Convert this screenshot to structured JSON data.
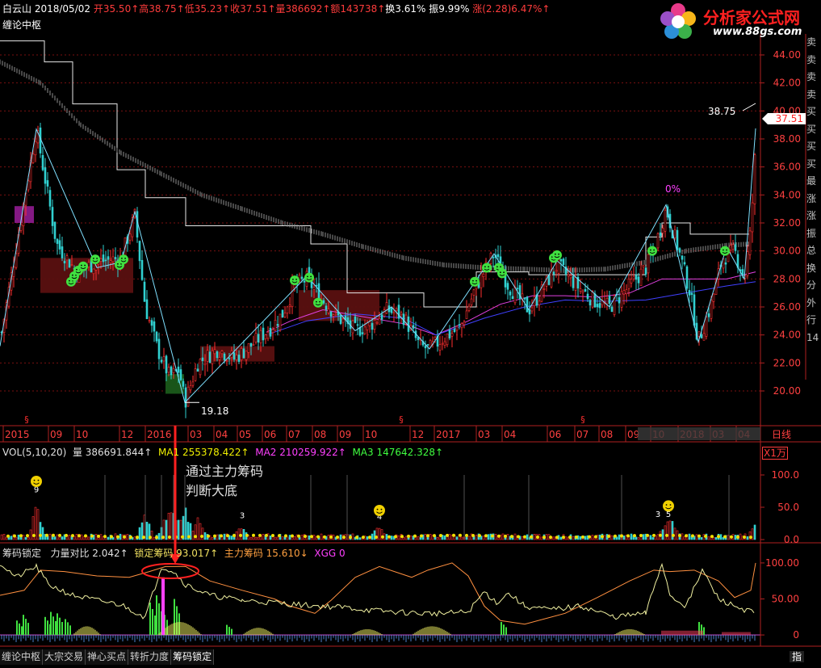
{
  "header": {
    "name": "白云山",
    "date": "2018/05/02",
    "open": "开35.50↑",
    "high": "高38.75↑",
    "low": "低35.23↑",
    "close": "收37.51↑",
    "volume": "量386692↑",
    "amount": "额143738↑",
    "turnover": "换3.61%",
    "amplitude": "振9.99%",
    "change": "涨(2.28)6.47%↑",
    "indicator_name": "缠论中枢"
  },
  "logo": {
    "title": "分析家公式网",
    "url_text": "www.88gs.com"
  },
  "right_panel": [
    "卖",
    "卖",
    "卖",
    "卖",
    "买",
    "买",
    "买",
    "买",
    "最",
    "涨",
    "涨",
    "振",
    "总",
    "换",
    "分",
    "外",
    "行",
    "14"
  ],
  "volume_header": {
    "label": "VOL(5,10,20)",
    "volume": "量 386691.844↑",
    "ma1": "MA1 255378.422↑",
    "ma2": "MA2 210259.922↑",
    "ma3": "MA3 147642.328↑",
    "unit": "X1万"
  },
  "chip_header": {
    "label": "筹码锁定",
    "ratio": "力量对比 2.042↑",
    "lock": "锁定筹码 93.017↑",
    "main": "主力筹码 15.610↓",
    "xgg": "XGG 0"
  },
  "annotation": {
    "line1": "通过主力筹码",
    "line2": "判断大底"
  },
  "price_labels": {
    "low_label": "19.18",
    "high_label": "38.75",
    "last_price": "37.51",
    "pct_label": "0%"
  },
  "tabs": [
    "缠论中枢",
    "大宗交易",
    "禅心买点",
    "转折力度",
    "筹码锁定"
  ],
  "corner_tab": "指",
  "chart_data": [
    {
      "type": "candlestick",
      "title": "缠论中枢",
      "ylim": [
        18.5,
        45.5
      ],
      "yticks": [
        "20.00",
        "22.00",
        "24.00",
        "26.00",
        "28.00",
        "30.00",
        "32.00",
        "34.00",
        "36.00",
        "38.00",
        "40.00",
        "42.00",
        "44.00"
      ],
      "x_ticks": [
        "2015",
        "09",
        "10",
        "12",
        "2016",
        "03",
        "04",
        "05",
        "06",
        "07",
        "08",
        "09",
        "10",
        "12",
        "2017",
        "03",
        "04",
        "06",
        "07",
        "08",
        "09",
        "10",
        "2018",
        "03",
        "04"
      ],
      "period_label": "日线",
      "close_path": [
        [
          0,
          23.5
        ],
        [
          45,
          38.7
        ],
        [
          70,
          30.5
        ],
        [
          95,
          28.5
        ],
        [
          120,
          29.2
        ],
        [
          150,
          29.5
        ],
        [
          167,
          32.5
        ],
        [
          180,
          26.0
        ],
        [
          195,
          23.0
        ],
        [
          210,
          21.0
        ],
        [
          222,
          21.5
        ],
        [
          229,
          19.2
        ],
        [
          245,
          22.0
        ],
        [
          270,
          23.0
        ],
        [
          290,
          22.3
        ],
        [
          310,
          23.2
        ],
        [
          335,
          24.5
        ],
        [
          350,
          25.5
        ],
        [
          365,
          27.5
        ],
        [
          380,
          28.0
        ],
        [
          400,
          26.5
        ],
        [
          420,
          25.2
        ],
        [
          440,
          24.3
        ],
        [
          460,
          24.8
        ],
        [
          480,
          25.8
        ],
        [
          500,
          25.3
        ],
        [
          520,
          23.2
        ],
        [
          532,
          23.0
        ],
        [
          550,
          23.8
        ],
        [
          570,
          24.5
        ],
        [
          590,
          27.5
        ],
        [
          612,
          29.8
        ],
        [
          630,
          27.5
        ],
        [
          655,
          25.8
        ],
        [
          670,
          27.0
        ],
        [
          690,
          29.0
        ],
        [
          715,
          27.5
        ],
        [
          735,
          26.5
        ],
        [
          755,
          26.0
        ],
        [
          780,
          27.5
        ],
        [
          800,
          28.8
        ],
        [
          810,
          30.0
        ],
        [
          825,
          33.0
        ],
        [
          840,
          30.2
        ],
        [
          855,
          27.0
        ],
        [
          865,
          23.5
        ],
        [
          880,
          26.0
        ],
        [
          895,
          29.5
        ],
        [
          910,
          30.0
        ],
        [
          922,
          28.0
        ],
        [
          930,
          31.5
        ],
        [
          936,
          37.5
        ]
      ],
      "zigzag": [
        [
          0,
          23.2
        ],
        [
          45,
          38.7
        ],
        [
          120,
          28.8
        ],
        [
          150,
          29.2
        ],
        [
          167,
          32.8
        ],
        [
          229,
          19.18
        ],
        [
          380,
          28.2
        ],
        [
          440,
          24.3
        ],
        [
          485,
          26.0
        ],
        [
          532,
          23.0
        ],
        [
          612,
          29.8
        ],
        [
          655,
          25.8
        ],
        [
          690,
          29.3
        ],
        [
          755,
          26.0
        ],
        [
          825,
          33.3
        ],
        [
          865,
          23.5
        ],
        [
          900,
          30.3
        ],
        [
          922,
          28.0
        ],
        [
          936,
          38.75
        ]
      ],
      "zhongshu": [
        {
          "x0": 50,
          "x1": 165,
          "low": 27.0,
          "high": 29.5,
          "color": "#5a1010"
        },
        {
          "x0": 248,
          "x1": 340,
          "low": 22.1,
          "high": 23.2,
          "color": "#5a1010"
        },
        {
          "x0": 370,
          "x1": 470,
          "low": 25.0,
          "high": 27.2,
          "color": "#5a1010"
        },
        {
          "x0": 205,
          "x1": 228,
          "low": 19.8,
          "high": 21.2,
          "color": "#1a5a1a"
        },
        {
          "x0": 18,
          "x1": 42,
          "low": 32.0,
          "high": 33.2,
          "color": "#8a1a8a"
        }
      ],
      "envelope_upper": [
        [
          0,
          45.0
        ],
        [
          55,
          45.0
        ],
        [
          55,
          43.5
        ],
        [
          90,
          43.5
        ],
        [
          90,
          40.5
        ],
        [
          145,
          40.5
        ],
        [
          145,
          35.8
        ],
        [
          180,
          35.8
        ],
        [
          180,
          33.8
        ],
        [
          230,
          33.8
        ],
        [
          230,
          31.8
        ],
        [
          385,
          31.8
        ],
        [
          385,
          30.5
        ],
        [
          430,
          30.5
        ],
        [
          430,
          27.0
        ],
        [
          525,
          27.0
        ],
        [
          525,
          26.0
        ],
        [
          590,
          26.0
        ],
        [
          590,
          28.5
        ],
        [
          655,
          28.5
        ],
        [
          655,
          28.3
        ],
        [
          800,
          28.3
        ],
        [
          800,
          31.0
        ],
        [
          820,
          31.0
        ],
        [
          820,
          32.0
        ],
        [
          855,
          32.0
        ],
        [
          855,
          31.2
        ],
        [
          930,
          31.2
        ]
      ],
      "long_ma": [
        [
          0,
          43.5
        ],
        [
          50,
          42.0
        ],
        [
          100,
          39.0
        ],
        [
          150,
          37.0
        ],
        [
          200,
          35.5
        ],
        [
          250,
          34.0
        ],
        [
          300,
          33.0
        ],
        [
          350,
          32.0
        ],
        [
          400,
          31.2
        ],
        [
          450,
          30.3
        ],
        [
          500,
          29.5
        ],
        [
          550,
          29.0
        ],
        [
          600,
          28.8
        ],
        [
          650,
          28.7
        ],
        [
          700,
          28.6
        ],
        [
          750,
          28.7
        ],
        [
          800,
          29.2
        ],
        [
          850,
          30.0
        ],
        [
          900,
          30.4
        ],
        [
          930,
          30.5
        ]
      ],
      "ma_pink": [
        [
          330,
          24.2
        ],
        [
          360,
          25.0
        ],
        [
          400,
          25.8
        ],
        [
          450,
          25.3
        ],
        [
          500,
          24.8
        ],
        [
          540,
          24.0
        ],
        [
          580,
          25.0
        ],
        [
          620,
          26.2
        ],
        [
          660,
          26.8
        ],
        [
          700,
          26.8
        ],
        [
          740,
          26.7
        ],
        [
          780,
          27.0
        ],
        [
          820,
          28.0
        ],
        [
          860,
          28.0
        ],
        [
          900,
          28.0
        ],
        [
          936,
          28.5
        ]
      ],
      "ma_blue": [
        [
          330,
          24.0
        ],
        [
          380,
          25.0
        ],
        [
          440,
          25.5
        ],
        [
          500,
          25.2
        ],
        [
          540,
          24.0
        ],
        [
          600,
          25.2
        ],
        [
          650,
          26.0
        ],
        [
          700,
          26.5
        ],
        [
          750,
          26.4
        ],
        [
          800,
          26.5
        ],
        [
          850,
          27.0
        ],
        [
          900,
          27.5
        ],
        [
          936,
          27.8
        ]
      ],
      "smileys": [
        [
          88,
          27.8
        ],
        [
          92,
          28.2
        ],
        [
          97,
          28.6
        ],
        [
          103,
          28.9
        ],
        [
          118,
          29.4
        ],
        [
          148,
          29.0
        ],
        [
          153,
          29.4
        ],
        [
          365,
          27.9
        ],
        [
          383,
          28.1
        ],
        [
          394,
          26.3
        ],
        [
          588,
          27.8
        ],
        [
          603,
          28.8
        ],
        [
          618,
          28.8
        ],
        [
          622,
          28.4
        ],
        [
          686,
          29.5
        ],
        [
          690,
          29.7
        ],
        [
          808,
          30.0
        ],
        [
          898,
          30.0
        ]
      ],
      "signals_x": [
        33,
        497,
        722
      ]
    },
    {
      "type": "bar",
      "title": "VOL(5,10,20)",
      "ylim": [
        0,
        120
      ],
      "yticks": [
        "0.0",
        "50.0",
        "100.0"
      ],
      "unit": "X1万",
      "spikes": [
        [
          45,
          60
        ],
        [
          180,
          45
        ],
        [
          205,
          40
        ],
        [
          215,
          42
        ],
        [
          229,
          50
        ],
        [
          245,
          35
        ],
        [
          300,
          20
        ],
        [
          470,
          18
        ],
        [
          825,
          22
        ],
        [
          832,
          25
        ],
        [
          936,
          28
        ]
      ],
      "spike_labels": [
        {
          "x": 45,
          "text": "9"
        },
        {
          "x": 300,
          "text": "3"
        },
        {
          "x": 470,
          "text": "4"
        },
        {
          "x": 815,
          "text": "3"
        },
        {
          "x": 828,
          "text": "5"
        }
      ],
      "smileys": [
        [
          45,
          90
        ],
        [
          470,
          45
        ],
        [
          828,
          52
        ]
      ]
    },
    {
      "type": "line",
      "title": "筹码锁定",
      "ylim": [
        -10,
        110
      ],
      "yticks": [
        "0",
        "50.00",
        "100.00"
      ],
      "lock_line": [
        [
          0,
          55
        ],
        [
          30,
          62
        ],
        [
          50,
          90
        ],
        [
          80,
          88
        ],
        [
          120,
          82
        ],
        [
          160,
          80
        ],
        [
          185,
          88
        ],
        [
          205,
          95
        ],
        [
          230,
          95
        ],
        [
          260,
          75
        ],
        [
          300,
          62
        ],
        [
          340,
          50
        ],
        [
          360,
          40
        ],
        [
          390,
          30
        ],
        [
          410,
          48
        ],
        [
          440,
          80
        ],
        [
          470,
          95
        ],
        [
          510,
          80
        ],
        [
          530,
          90
        ],
        [
          560,
          100
        ],
        [
          580,
          82
        ],
        [
          600,
          40
        ],
        [
          620,
          20
        ],
        [
          650,
          15
        ],
        [
          700,
          30
        ],
        [
          740,
          52
        ],
        [
          780,
          75
        ],
        [
          810,
          90
        ],
        [
          830,
          88
        ],
        [
          860,
          90
        ],
        [
          890,
          75
        ],
        [
          910,
          52
        ],
        [
          930,
          62
        ],
        [
          936,
          100
        ]
      ],
      "main_line": [
        [
          0,
          100
        ],
        [
          20,
          80
        ],
        [
          45,
          95
        ],
        [
          60,
          70
        ],
        [
          90,
          55
        ],
        [
          120,
          48
        ],
        [
          150,
          42
        ],
        [
          180,
          25
        ],
        [
          200,
          95
        ],
        [
          215,
          88
        ],
        [
          230,
          70
        ],
        [
          260,
          55
        ],
        [
          300,
          48
        ],
        [
          340,
          45
        ],
        [
          370,
          42
        ],
        [
          400,
          40
        ],
        [
          430,
          38
        ],
        [
          460,
          34
        ],
        [
          490,
          32
        ],
        [
          520,
          30
        ],
        [
          550,
          30
        ],
        [
          580,
          32
        ],
        [
          600,
          60
        ],
        [
          615,
          45
        ],
        [
          630,
          58
        ],
        [
          650,
          40
        ],
        [
          680,
          35
        ],
        [
          720,
          40
        ],
        [
          760,
          25
        ],
        [
          800,
          30
        ],
        [
          820,
          100
        ],
        [
          830,
          55
        ],
        [
          850,
          40
        ],
        [
          870,
          90
        ],
        [
          890,
          50
        ],
        [
          910,
          40
        ],
        [
          936,
          30
        ]
      ],
      "green_bars": [
        [
          20,
          20
        ],
        [
          28,
          28
        ],
        [
          55,
          25
        ],
        [
          62,
          32
        ],
        [
          70,
          30
        ],
        [
          80,
          22
        ],
        [
          185,
          45
        ],
        [
          193,
          55
        ],
        [
          200,
          35
        ],
        [
          215,
          50
        ],
        [
          280,
          14
        ],
        [
          620,
          18
        ],
        [
          865,
          18
        ]
      ],
      "yellow_humps": [
        [
          90,
          125,
          12
        ],
        [
          195,
          250,
          18
        ],
        [
          300,
          340,
          10
        ],
        [
          435,
          475,
          8
        ],
        [
          510,
          560,
          12
        ],
        [
          760,
          800,
          8
        ]
      ],
      "red_bars": [
        [
          820,
          870,
          6
        ],
        [
          895,
          930,
          4
        ]
      ],
      "xgg_bars": [
        [
          200,
          80
        ]
      ]
    }
  ]
}
